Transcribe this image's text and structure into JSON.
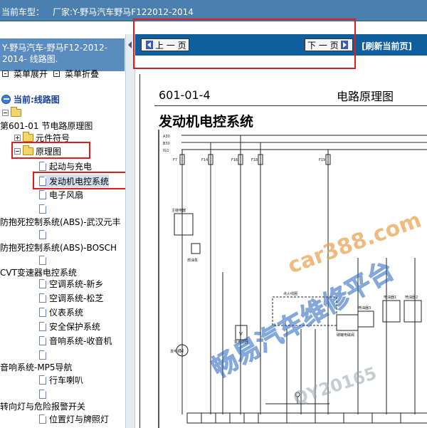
{
  "window": {
    "current_car_label": "当前车型：",
    "manufacturer": "厂家:Y-野马汽车野马F122012-2014"
  },
  "left_pane": {
    "title": "Y-野马汽车-野马F12-2012-2014- 线路图.",
    "expand_all": "菜单展开",
    "collapse_all": "菜单折叠",
    "current_label": "当前:线路图",
    "tree": {
      "section": "第601-01 节电路原理图",
      "component_symbols": "元件符号",
      "schematic": "原理图",
      "items": [
        "起动与充电",
        "发动机电控系统",
        "电子风扇"
      ],
      "abs_wuhan": "防抱死控制系统(ABS)-武汉元丰",
      "abs_bosch": "防抱死控制系统(ABS)-BOSCH",
      "cvt": "CVT变速器电控系统",
      "cvt_children": [
        "空调系统-新乡",
        "空调系统-松芝",
        "仪表系统",
        "安全保护系统",
        "音响系统-收音机"
      ],
      "audio_mp5": "音响系统-MP5导航",
      "horn": "行车喇叭",
      "turn_signal": "转向灯与危险报警开关",
      "position_lamp": "位置灯与牌照灯"
    }
  },
  "toolbar": {
    "prev_label": "上 一 页",
    "next_label": "下 一 页",
    "refresh_label": "[刷新当前页]"
  },
  "document": {
    "page_code": "601-01-4",
    "page_label": "电路原理图",
    "title": "发动机电控系统",
    "bus_labels": [
      "A30",
      "B30",
      "IG1"
    ],
    "fuses": [
      "F7",
      "F14",
      "F16",
      "F18",
      "F19"
    ],
    "component_labels": [
      "发电机",
      "点火线圈",
      "氧传感器",
      "喷油器1",
      "喷油器2",
      "喷油器3",
      "碳罐电磁阀",
      "主继电器",
      "燃油泵"
    ]
  },
  "watermark": {
    "site": "car388.com",
    "slogan": "畅易汽车维修平台",
    "code": "QY20165"
  },
  "colors": {
    "topbar": "#4a7fb0",
    "left_title": "#5a8cc0",
    "navbar": "#0e5f9c",
    "highlight": "#e21c1c",
    "watermark_blue": "#2f7fe0",
    "watermark_orange": "#e8a04a"
  }
}
